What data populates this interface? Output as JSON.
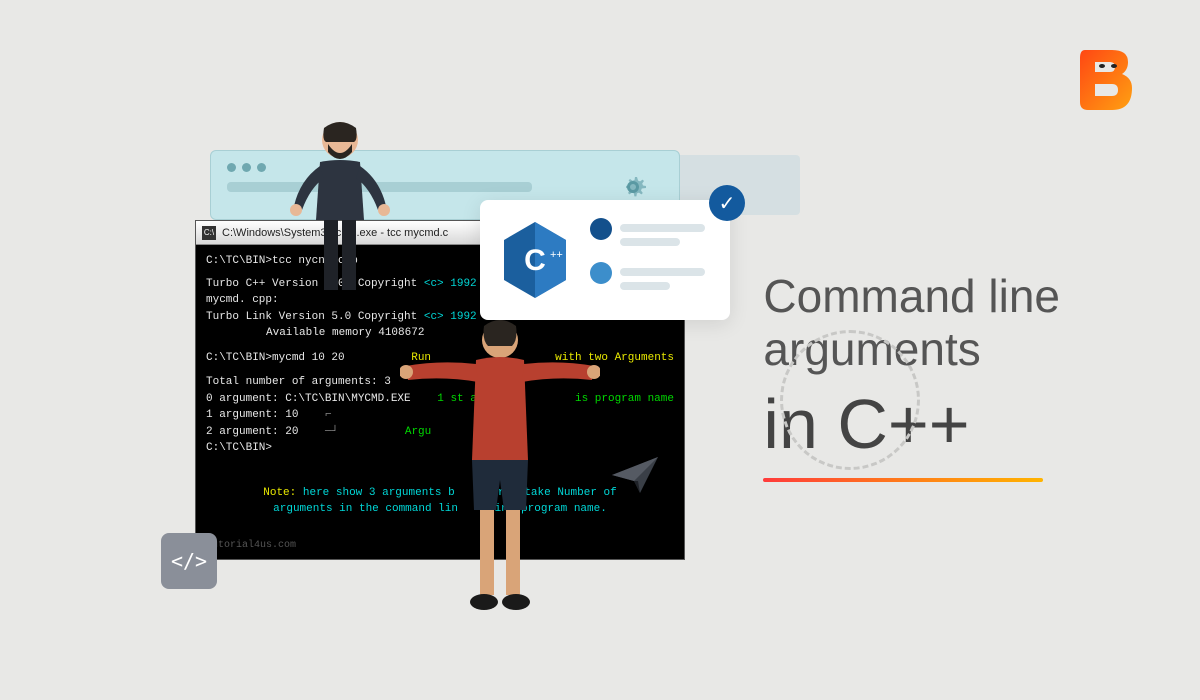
{
  "logo": {
    "name": "coding-ninjas"
  },
  "title": {
    "line1": "Command line",
    "line2": "arguments",
    "line3": "in C++"
  },
  "terminal": {
    "titlebar": "C:\\Windows\\System32\\cmd.exe - tcc  mycmd.c",
    "lines": {
      "l1a": "C:\\TC\\BIN>tcc nycnd.cpp",
      "l1b": "Co",
      "l2": "Turbo C++  Version 3.00 Copyright",
      "l2b": "<c> 1992 Borland International",
      "l3": "mycmd. cpp:",
      "l4": "Turbo Link   Version 5.0 Copyright",
      "l4b": "<c> 1992 Borland International",
      "l5": "Available memory 4108672",
      "l6a": "C:\\TC\\BIN>mycmd 10 20",
      "l6b": "Run",
      "l6c": "with two Arguments",
      "l7": "Total number of arguments: 3",
      "l8a": "0  argument: C:\\TC\\BIN\\MYCMD.EXE",
      "l8b": "1 st ar",
      "l8c": "is program name",
      "l9": "1  argument:  10",
      "l10a": "2  argument:  20",
      "l10b": "Argu",
      "l11": "C:\\TC\\BIN>",
      "note_label": "Note:",
      "note_text1": "here show 3 arguments b",
      "note_text2": "argc take Number of",
      "note_text3": "arguments in the command lin",
      "note_text4": "ing program name.",
      "watermark": "Tutorial4us.com"
    }
  },
  "icons": {
    "gear": "gear-icon",
    "check": "✓",
    "code": "</>",
    "cpp": "C++"
  }
}
